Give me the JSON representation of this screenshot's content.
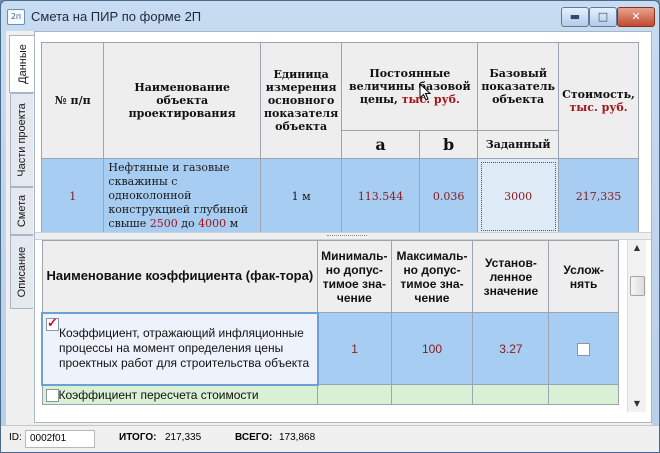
{
  "window": {
    "title": "Смета на ПИР по форме 2П",
    "icon_text": "2п",
    "buttons": {
      "min": "▬",
      "max": "□",
      "close": "✕"
    }
  },
  "tabs": [
    "Данные",
    "Части проекта",
    "Смета",
    "Описание"
  ],
  "top_table": {
    "headers": {
      "num": "№ п/п",
      "name": "Наименование объекта проектирования",
      "unit": "Единица измерения основного показателя объекта",
      "const_prefix": "Постоянные величины базовой цены,",
      "const_unit": "тыс. руб.",
      "base": "Базовый показатель объекта",
      "cost_prefix": "Стоимость,",
      "cost_unit": "тыс. руб.",
      "a": "a",
      "b": "b",
      "given": "Заданный"
    },
    "row": {
      "num": "1",
      "name_text": "Нефтяные и газовые скважины с одноколонной конструкцией глубиной свыше",
      "from": "2500",
      "to_word": "до",
      "to": "4000",
      "unit_suffix": "м",
      "unit": "1 м",
      "a": "113.544",
      "b": "0.036",
      "given": "3000",
      "cost": "217,335"
    }
  },
  "coef_table": {
    "headers": {
      "name": "Наименование коэффициента (фак-тора)",
      "min": "Минималь-но допус-тимое зна-чение",
      "max": "Максималь-но допус-тимое зна-чение",
      "set": "Установ-ленное значение",
      "compl": "Услож-нять"
    },
    "rows": [
      {
        "checked": true,
        "name": "Коэффициент, отражающий инфляционные процессы на момент определения цены проектных работ для строительства объекта",
        "min": "1",
        "max": "100",
        "value": "3.27",
        "complicate": false
      },
      {
        "checked": false,
        "name": "Коэффициент пересчета стоимости",
        "min": "",
        "max": "",
        "value": "",
        "complicate": false
      }
    ]
  },
  "scrollbar": {
    "up": "▲",
    "down": "▼"
  },
  "status": {
    "id_label": "ID:",
    "id_value": "0002f01",
    "total_label": "ИТОГО:",
    "total_value": "217,335",
    "all_label": "ВСЕГО:",
    "all_value": "173,868"
  },
  "colors": {
    "accent_red": "#a0151a",
    "selected_row": "#a8cdf2",
    "green_row": "#d9f0d4"
  }
}
